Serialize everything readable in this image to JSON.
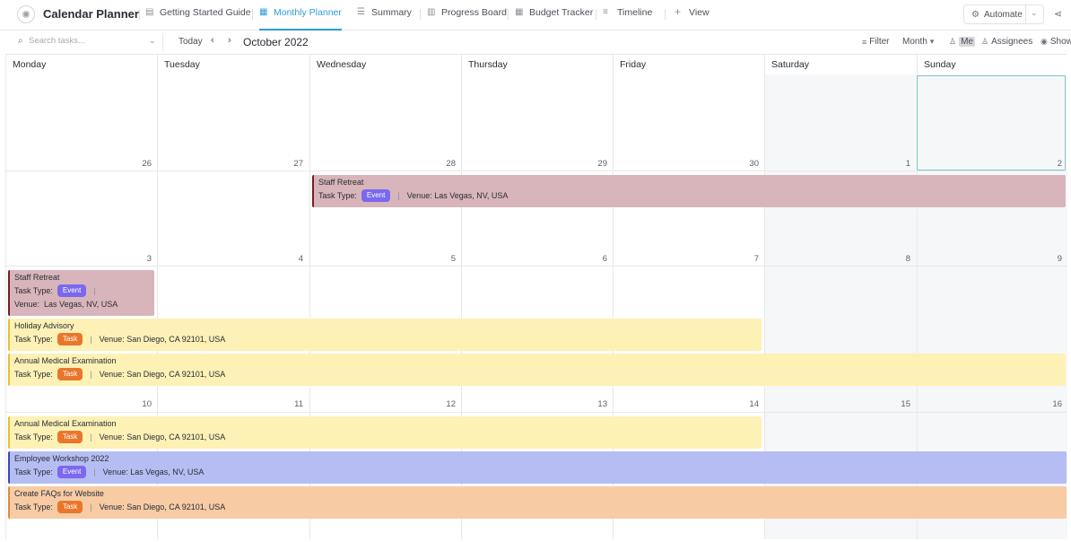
{
  "app": {
    "title": "Calendar Planner",
    "icon": "gear-spinner-icon"
  },
  "tabs": [
    {
      "label": "Getting Started Guide",
      "icon": "doc-icon"
    },
    {
      "label": "Monthly Planner",
      "icon": "calendar-icon",
      "active": true
    },
    {
      "label": "Summary",
      "icon": "list-icon"
    },
    {
      "label": "Progress Board",
      "icon": "board-icon"
    },
    {
      "label": "Budget Tracker",
      "icon": "table-icon"
    },
    {
      "label": "Timeline",
      "icon": "timeline-icon"
    },
    {
      "label": "View",
      "icon": "plus-icon"
    }
  ],
  "header_right": {
    "automate_label": "Automate"
  },
  "toolbar": {
    "search_placeholder": "Search tasks...",
    "today_label": "Today",
    "month_label": "October 2022",
    "filter_label": "Filter",
    "view_mode_label": "Month",
    "me_label": "Me",
    "assignees_label": "Assignees",
    "show_label": "Show"
  },
  "calendar": {
    "weekdays": [
      "Monday",
      "Tuesday",
      "Wednesday",
      "Thursday",
      "Friday",
      "Saturday",
      "Sunday"
    ],
    "weeks": [
      [
        "26",
        "27",
        "28",
        "29",
        "30",
        "1",
        "2"
      ],
      [
        "3",
        "4",
        "5",
        "6",
        "7",
        "8",
        "9"
      ],
      [
        "10",
        "11",
        "12",
        "13",
        "14",
        "15",
        "16"
      ],
      [
        "",
        "",
        "",
        "",
        "",
        "",
        ""
      ]
    ],
    "today": "2"
  },
  "events": [
    {
      "title": "Staff Retreat",
      "task_type_label": "Task Type:",
      "badge": "Event",
      "venue_label": "Venue:",
      "venue": "Las Vegas, NV, USA",
      "color": "#d8b5bb"
    },
    {
      "title": "Staff Retreat",
      "task_type_label": "Task Type:",
      "badge": "Event",
      "venue_label": "Venue:",
      "venue": "Las Vegas, NV, USA",
      "color": "#d8b5bb"
    },
    {
      "title": "Holiday Advisory",
      "task_type_label": "Task Type:",
      "badge": "Task",
      "venue_label": "Venue:",
      "venue": "San Diego, CA 92101, USA",
      "color": "#fdf1b5"
    },
    {
      "title": "Annual Medical Examination",
      "task_type_label": "Task Type:",
      "badge": "Task",
      "venue_label": "Venue:",
      "venue": "San Diego, CA 92101, USA",
      "color": "#fdf1b5"
    },
    {
      "title": "Annual Medical Examination",
      "task_type_label": "Task Type:",
      "badge": "Task",
      "venue_label": "Venue:",
      "venue": "San Diego, CA 92101, USA",
      "color": "#fdf1b5"
    },
    {
      "title": "Employee Workshop 2022",
      "task_type_label": "Task Type:",
      "badge": "Event",
      "venue_label": "Venue:",
      "venue": "Las Vegas, NV, USA",
      "color": "#b6bdf2"
    },
    {
      "title": "Create FAQs for Website",
      "task_type_label": "Task Type:",
      "badge": "Task",
      "venue_label": "Venue:",
      "venue": "San Diego, CA 92101, USA",
      "color": "#f7cba4"
    }
  ]
}
